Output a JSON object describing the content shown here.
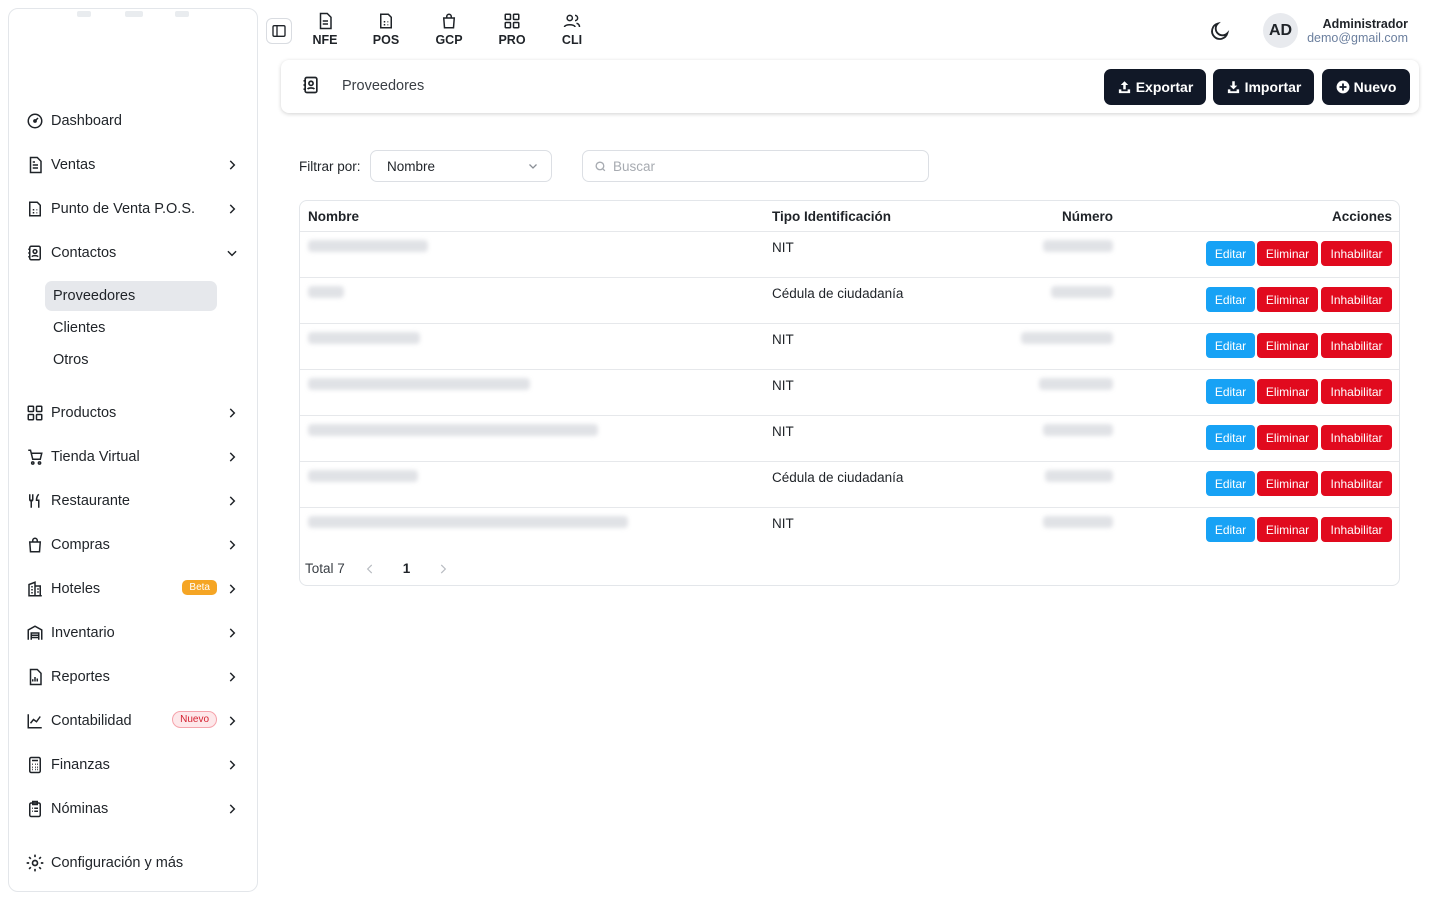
{
  "sidebar": {
    "items": [
      {
        "label": "Dashboard",
        "icon": "dashboard-icon",
        "has_chevron": false
      },
      {
        "label": "Ventas",
        "icon": "document-icon",
        "has_chevron": true
      },
      {
        "label": "Punto de Venta P.O.S.",
        "icon": "pos-icon",
        "has_chevron": true
      },
      {
        "label": "Contactos",
        "icon": "contacts-icon",
        "has_chevron": true,
        "expanded": true
      },
      {
        "label": "Productos",
        "icon": "grid-icon",
        "has_chevron": true
      },
      {
        "label": "Tienda Virtual",
        "icon": "cart-icon",
        "has_chevron": true
      },
      {
        "label": "Restaurante",
        "icon": "utensils-icon",
        "has_chevron": true
      },
      {
        "label": "Compras",
        "icon": "bag-icon",
        "has_chevron": true
      },
      {
        "label": "Hoteles",
        "icon": "building-icon",
        "has_chevron": true,
        "badge": "Beta"
      },
      {
        "label": "Inventario",
        "icon": "warehouse-icon",
        "has_chevron": true
      },
      {
        "label": "Reportes",
        "icon": "report-icon",
        "has_chevron": true
      },
      {
        "label": "Contabilidad",
        "icon": "chart-icon",
        "has_chevron": true,
        "badge": "Nuevo"
      },
      {
        "label": "Finanzas",
        "icon": "calculator-icon",
        "has_chevron": true
      },
      {
        "label": "Nóminas",
        "icon": "clipboard-icon",
        "has_chevron": true
      },
      {
        "label": "Configuración y más",
        "icon": "gear-icon",
        "has_chevron": false
      }
    ],
    "contactos_sub": [
      {
        "label": "Proveedores",
        "active": true
      },
      {
        "label": "Clientes",
        "active": false
      },
      {
        "label": "Otros",
        "active": false
      }
    ]
  },
  "topbar": {
    "quick_links": [
      "NFE",
      "POS",
      "GCP",
      "PRO",
      "CLI"
    ],
    "avatar_initials": "AD",
    "user_name": "Administrador",
    "user_email": "demo@gmail.com"
  },
  "header": {
    "title": "Proveedores",
    "export_label": "Exportar",
    "import_label": "Importar",
    "new_label": "Nuevo"
  },
  "filter": {
    "label": "Filtrar por:",
    "selected": "Nombre",
    "search_placeholder": "Buscar"
  },
  "table": {
    "columns": [
      "Nombre",
      "Tipo Identificación",
      "Número",
      "Acciones"
    ],
    "rows": [
      {
        "tipo": "NIT"
      },
      {
        "tipo": "Cédula de ciudadanía"
      },
      {
        "tipo": "NIT"
      },
      {
        "tipo": "NIT"
      },
      {
        "tipo": "NIT"
      },
      {
        "tipo": "Cédula de ciudadanía"
      },
      {
        "tipo": "NIT"
      }
    ],
    "actions": {
      "edit": "Editar",
      "delete": "Eliminar",
      "disable": "Inhabilitar"
    }
  },
  "pagination": {
    "total_label": "Total 7",
    "current_page": "1"
  },
  "colors": {
    "primary_dark": "#111827",
    "edit_blue": "#17a2f5",
    "danger_red": "#e10a1e",
    "beta_orange": "#f5a524"
  }
}
